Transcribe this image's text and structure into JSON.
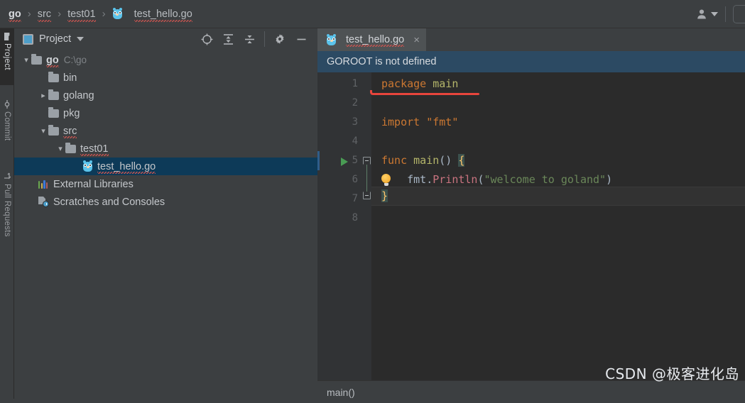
{
  "breadcrumb": {
    "items": [
      {
        "label": "go",
        "bold": true
      },
      {
        "label": "src",
        "bold": false
      },
      {
        "label": "test01",
        "bold": false
      },
      {
        "label": "test_hello.go",
        "bold": false
      }
    ],
    "separator": "›"
  },
  "topbar": {
    "user_icon": "user-avatar-icon",
    "caret": "▾"
  },
  "toolstrip": {
    "tabs": [
      {
        "label": "Project",
        "icon": "folder-icon",
        "active": true
      },
      {
        "label": "Commit",
        "icon": "commit-icon",
        "active": false
      },
      {
        "label": "Pull Requests",
        "icon": "pull-request-icon",
        "active": false
      }
    ]
  },
  "project_panel": {
    "title": "Project",
    "actions": [
      {
        "name": "select-opened-file-icon",
        "glyph": "⊕"
      },
      {
        "name": "expand-all-icon",
        "glyph": "↕"
      },
      {
        "name": "collapse-all-icon",
        "glyph": "↕"
      },
      {
        "name": "settings-gear-icon",
        "glyph": "⚙"
      },
      {
        "name": "hide-panel-icon",
        "glyph": "–"
      }
    ],
    "tree": [
      {
        "label": "go",
        "path": "C:\\go",
        "icon": "folder-icon",
        "indent": 0,
        "arrow": "expanded",
        "bold": true,
        "squiggly": true,
        "selected": false
      },
      {
        "label": "bin",
        "path": "",
        "icon": "folder-icon",
        "indent": 1,
        "arrow": "none",
        "bold": false,
        "squiggly": false,
        "selected": false
      },
      {
        "label": "golang",
        "path": "",
        "icon": "folder-icon",
        "indent": 1,
        "arrow": "collapsed",
        "bold": false,
        "squiggly": false,
        "selected": false
      },
      {
        "label": "pkg",
        "path": "",
        "icon": "folder-icon",
        "indent": 1,
        "arrow": "none",
        "bold": false,
        "squiggly": false,
        "selected": false
      },
      {
        "label": "src",
        "path": "",
        "icon": "folder-icon",
        "indent": 1,
        "arrow": "expanded",
        "bold": false,
        "squiggly": true,
        "selected": false
      },
      {
        "label": "test01",
        "path": "",
        "icon": "folder-icon",
        "indent": 2,
        "arrow": "expanded",
        "bold": false,
        "squiggly": true,
        "selected": false
      },
      {
        "label": "test_hello.go",
        "path": "",
        "icon": "go-file-icon",
        "indent": 3,
        "arrow": "none",
        "bold": false,
        "squiggly": true,
        "selected": true
      },
      {
        "label": "External Libraries",
        "path": "",
        "icon": "external-libraries-icon",
        "indent": 0,
        "arrow": "none",
        "bold": false,
        "squiggly": false,
        "selected": false
      },
      {
        "label": "Scratches and Consoles",
        "path": "",
        "icon": "scratches-icon",
        "indent": 0,
        "arrow": "none",
        "bold": false,
        "squiggly": false,
        "selected": false
      }
    ]
  },
  "editor": {
    "tab": {
      "label": "test_hello.go",
      "icon": "go-file-icon",
      "close": "×"
    },
    "banner": {
      "text": "GOROOT is not defined"
    },
    "line_numbers": [
      "1",
      "2",
      "3",
      "4",
      "5",
      "6",
      "7",
      "8"
    ],
    "code_lines": [
      {
        "n": 1,
        "tokens": [
          {
            "t": "package",
            "c": "kw"
          },
          {
            "t": " ",
            "c": "plain"
          },
          {
            "t": "main",
            "c": "fn"
          }
        ]
      },
      {
        "n": 2,
        "tokens": []
      },
      {
        "n": 3,
        "tokens": [
          {
            "t": "import",
            "c": "kw"
          },
          {
            "t": " ",
            "c": "plain"
          },
          {
            "t": "\"fmt\"",
            "c": "istr"
          }
        ]
      },
      {
        "n": 4,
        "tokens": []
      },
      {
        "n": 5,
        "tokens": [
          {
            "t": "func",
            "c": "kw"
          },
          {
            "t": " ",
            "c": "plain"
          },
          {
            "t": "main",
            "c": "fn"
          },
          {
            "t": "()",
            "c": "paren"
          },
          {
            "t": " ",
            "c": "plain"
          },
          {
            "t": "{",
            "c": "brace-hl"
          }
        ]
      },
      {
        "n": 6,
        "tokens": [
          {
            "t": "    fmt",
            "c": "plain"
          },
          {
            "t": ".",
            "c": "plain"
          },
          {
            "t": "Println",
            "c": "meth"
          },
          {
            "t": "(",
            "c": "paren"
          },
          {
            "t": "\"welcome to goland\"",
            "c": "str"
          },
          {
            "t": ")",
            "c": "paren"
          }
        ]
      },
      {
        "n": 7,
        "tokens": [
          {
            "t": "}",
            "c": "brace-y"
          }
        ]
      },
      {
        "n": 8,
        "tokens": []
      }
    ],
    "gutter_markers": {
      "run_arrow_line": 5,
      "bulb_line": 6,
      "fold_lines": [
        5,
        7
      ],
      "current_line": 7
    },
    "annotation": {
      "type": "red-underline",
      "target_line": 1,
      "target_text": "package main"
    }
  },
  "statusbar": {
    "text": "main()"
  },
  "watermark": {
    "text": "CSDN @极客进化岛"
  },
  "colors": {
    "bg_panel": "#3c3f41",
    "bg_editor": "#2b2b2b",
    "bg_gutter": "#313335",
    "accent_blue": "#2c4a63",
    "selection": "#0d3a58",
    "keyword": "#cc7832",
    "string": "#6a8759",
    "method": "#c9737f",
    "function": "#b5b66a",
    "run_green": "#499c54",
    "error_red": "#e8453c"
  }
}
